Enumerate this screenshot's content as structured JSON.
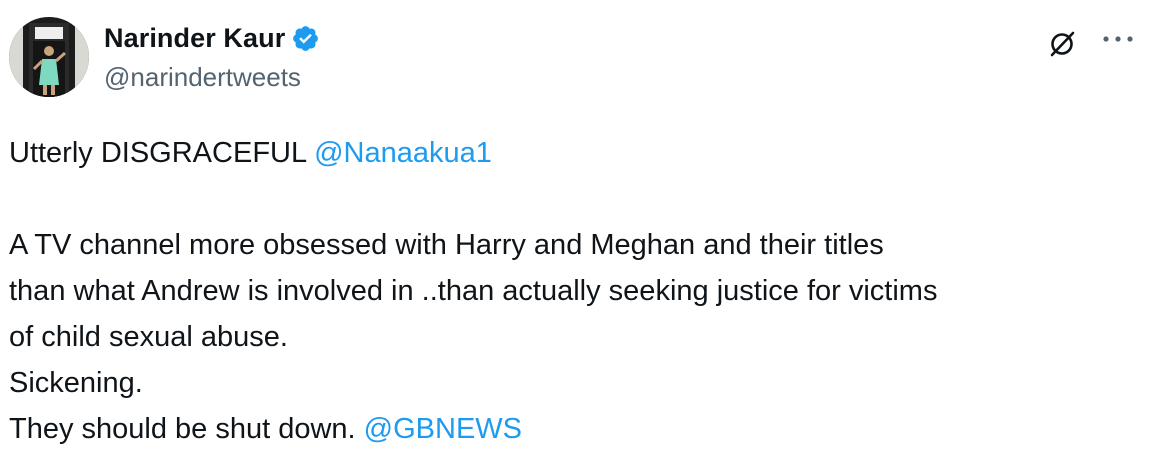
{
  "author": {
    "display_name": "Narinder Kaur",
    "handle": "@narindertweets",
    "verified": true,
    "avatar_icon": "profile-photo-avatar"
  },
  "header_actions": {
    "grok_icon": "grok-icon",
    "more_icon": "more-horizontal-icon"
  },
  "tweet": {
    "line1_text": "Utterly DISGRACEFUL ",
    "line1_mention": "@Nanaakua1",
    "line2": "A TV channel more obsessed with Harry and Meghan and their titles",
    "line3": "than what Andrew is involved in ..than actually seeking justice for victims",
    "line4": "of child sexual abuse.",
    "line5": "Sickening.",
    "line6_text": "They should be shut down. ",
    "line6_mention": "@GBNEWS"
  },
  "colors": {
    "text": "#0f1419",
    "secondary": "#536471",
    "link": "#1d9bf0",
    "verified_badge": "#1d9bf0",
    "background": "#ffffff"
  }
}
